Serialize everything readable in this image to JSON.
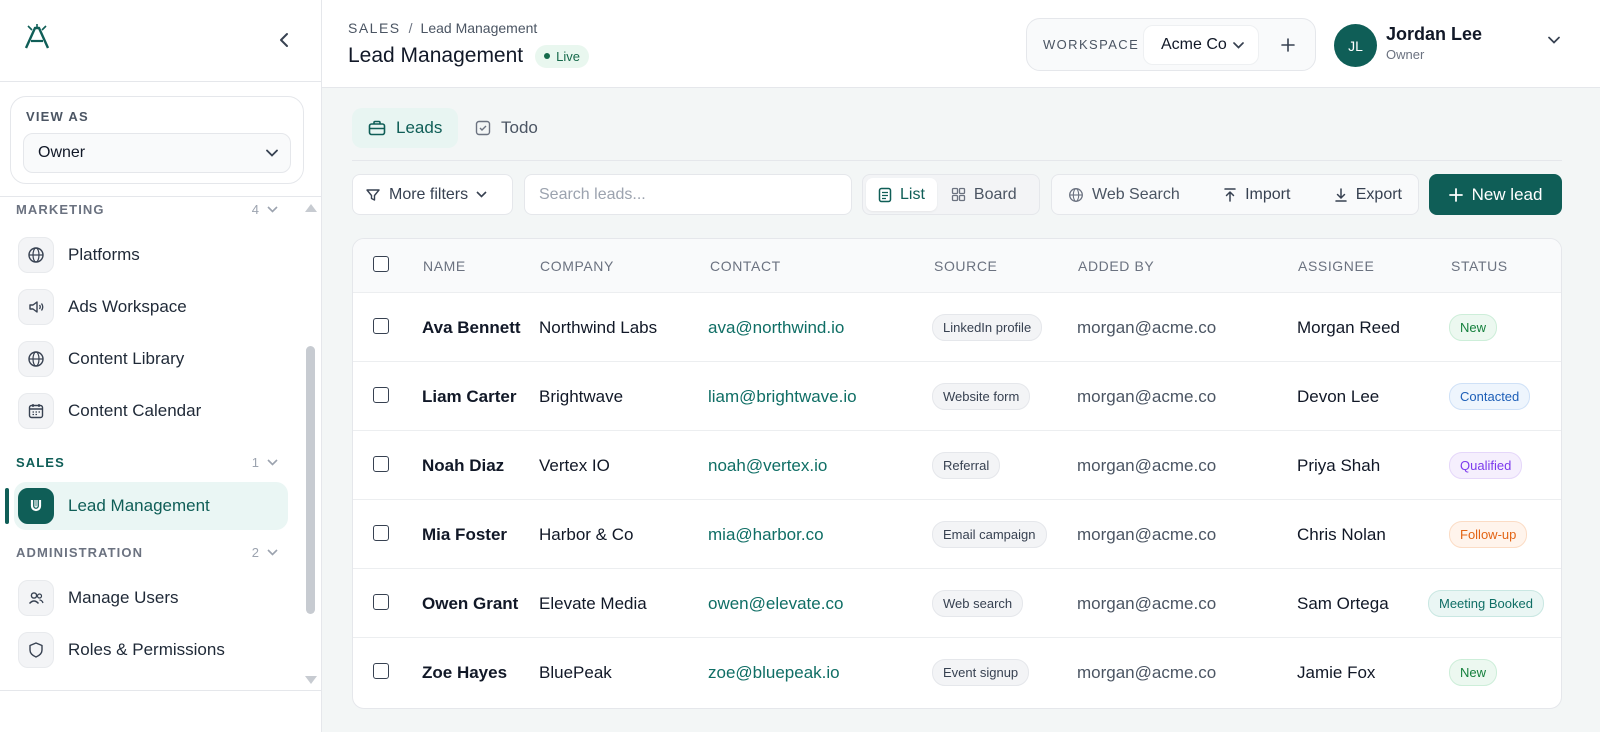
{
  "sidebar": {
    "view_as": {
      "label": "VIEW AS",
      "value": "Owner"
    },
    "sections": [
      {
        "label": "MARKETING",
        "count": "4",
        "items": [
          {
            "label": "Platforms",
            "icon": "globe-icon"
          },
          {
            "label": "Ads Workspace",
            "icon": "megaphone-icon"
          },
          {
            "label": "Content Library",
            "icon": "globe-icon"
          },
          {
            "label": "Content Calendar",
            "icon": "calendar-icon"
          }
        ]
      },
      {
        "label": "SALES",
        "count": "1",
        "items": [
          {
            "label": "Lead Management",
            "icon": "magnet-icon",
            "active": true
          }
        ]
      },
      {
        "label": "ADMINISTRATION",
        "count": "2",
        "items": [
          {
            "label": "Manage Users",
            "icon": "users-icon"
          },
          {
            "label": "Roles & Permissions",
            "icon": "shield-icon"
          }
        ]
      }
    ]
  },
  "header": {
    "breadcrumb": [
      "SALES",
      "/",
      "Lead Management"
    ],
    "title": "Lead Management",
    "badge": "Live",
    "workspace": {
      "label": "WORKSPACE",
      "value": "Acme Co"
    },
    "user": {
      "initials": "JL",
      "name": "Jordan Lee",
      "role": "Owner"
    }
  },
  "tabs": [
    {
      "label": "Leads",
      "active": true
    },
    {
      "label": "Todo",
      "active": false
    }
  ],
  "toolbar": {
    "filters_label": "More filters",
    "search_placeholder": "Search leads...",
    "view_list": "List",
    "view_board": "Board",
    "web_search": "Web Search",
    "import": "Import",
    "export": "Export",
    "new_lead": "New lead"
  },
  "table": {
    "columns": [
      "NAME",
      "COMPANY",
      "CONTACT",
      "SOURCE",
      "ADDED BY",
      "ASSIGNEE",
      "STATUS"
    ],
    "rows": [
      {
        "name": "Ava Bennett",
        "company": "Northwind Labs",
        "contact": "ava@northwind.io",
        "source": "LinkedIn profile",
        "added_by": "morgan@acme.co",
        "assignee": "Morgan Reed",
        "status": "New"
      },
      {
        "name": "Liam Carter",
        "company": "Brightwave",
        "contact": "liam@brightwave.io",
        "source": "Website form",
        "added_by": "morgan@acme.co",
        "assignee": "Devon Lee",
        "status": "Contacted"
      },
      {
        "name": "Noah Diaz",
        "company": "Vertex IO",
        "contact": "noah@vertex.io",
        "source": "Referral",
        "added_by": "morgan@acme.co",
        "assignee": "Priya Shah",
        "status": "Qualified"
      },
      {
        "name": "Mia Foster",
        "company": "Harbor & Co",
        "contact": "mia@harbor.co",
        "source": "Email campaign",
        "added_by": "morgan@acme.co",
        "assignee": "Chris Nolan",
        "status": "Follow-up"
      },
      {
        "name": "Owen Grant",
        "company": "Elevate Media",
        "contact": "owen@elevate.co",
        "source": "Web search",
        "added_by": "morgan@acme.co",
        "assignee": "Sam Ortega",
        "status": "Meeting Booked"
      },
      {
        "name": "Zoe Hayes",
        "company": "BluePeak",
        "contact": "zoe@bluepeak.io",
        "source": "Event signup",
        "added_by": "morgan@acme.co",
        "assignee": "Jamie Fox",
        "status": "New"
      }
    ]
  },
  "colors": {
    "brand": "#0f5e57",
    "status_new": "#16a34a",
    "status_contacted": "#2563eb",
    "status_qualified": "#7c3aed",
    "status_followup": "#ea580c",
    "status_meeting": "#0f6e65"
  }
}
